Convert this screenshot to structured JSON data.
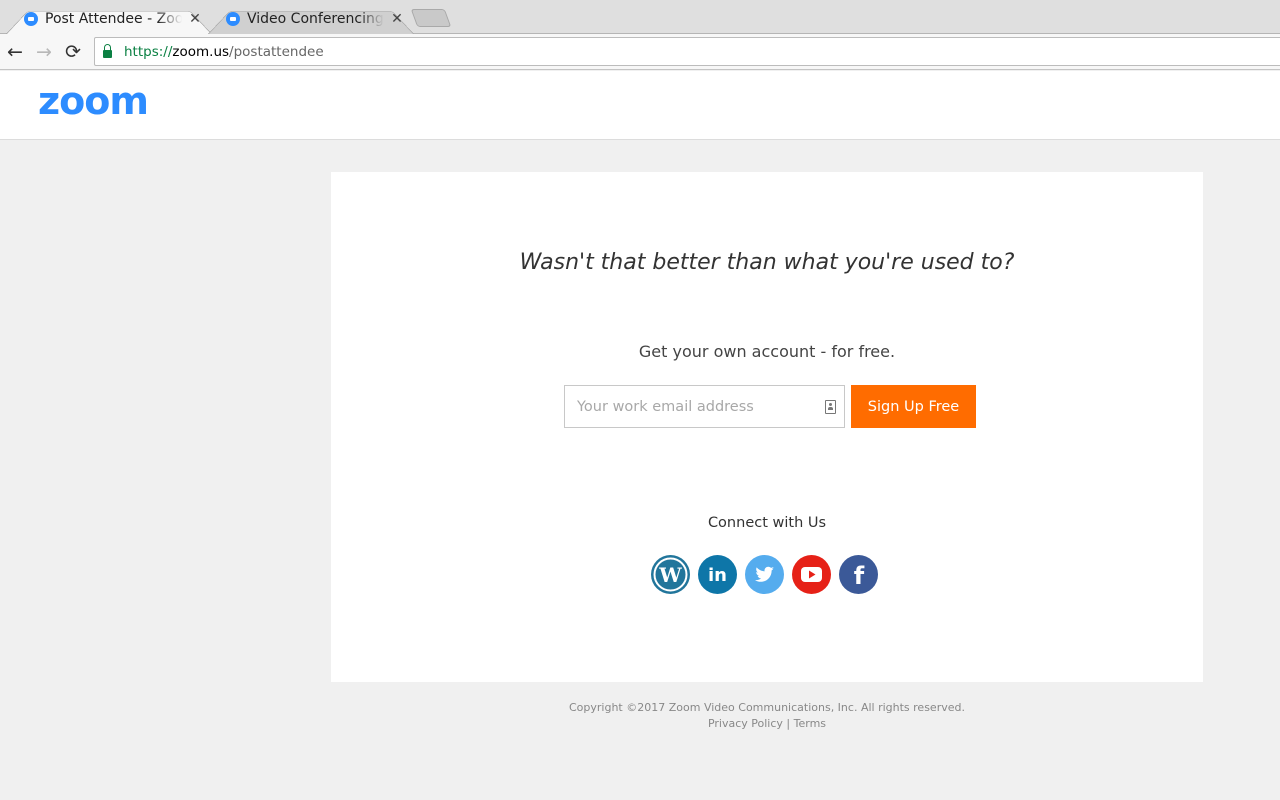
{
  "browser": {
    "tabs": [
      {
        "title": "Post Attendee - Zoom",
        "active": true,
        "close": "✕"
      },
      {
        "title": "Video Conferencing, Web Conferencing",
        "active": false,
        "close": "✕"
      }
    ],
    "nav": {
      "back": "←",
      "forward": "→",
      "reload": "⟳"
    },
    "url": {
      "scheme": "https://",
      "host": "zoom.us",
      "path": "/postattendee"
    }
  },
  "header": {
    "logo": "zoom"
  },
  "main": {
    "headline": "Wasn't that better than what you're used to?",
    "subhead": "Get your own account - for free.",
    "email": {
      "value": "",
      "placeholder": "Your work email address"
    },
    "signup_label": "Sign Up Free",
    "connect_label": "Connect with Us",
    "social": [
      {
        "name": "wordpress",
        "color": "#21759b"
      },
      {
        "name": "linkedin",
        "color": "#0e76a8"
      },
      {
        "name": "twitter",
        "color": "#55acee"
      },
      {
        "name": "youtube",
        "color": "#e62117"
      },
      {
        "name": "facebook",
        "color": "#3b5998"
      }
    ]
  },
  "footer": {
    "copyright": "Copyright ©2017 Zoom Video Communications, Inc. All rights reserved.",
    "privacy": "Privacy Policy",
    "separator": "|",
    "terms": "Terms"
  },
  "colors": {
    "brand": "#2d8cff",
    "cta": "#ff6c00",
    "secure": "#0b8043"
  }
}
